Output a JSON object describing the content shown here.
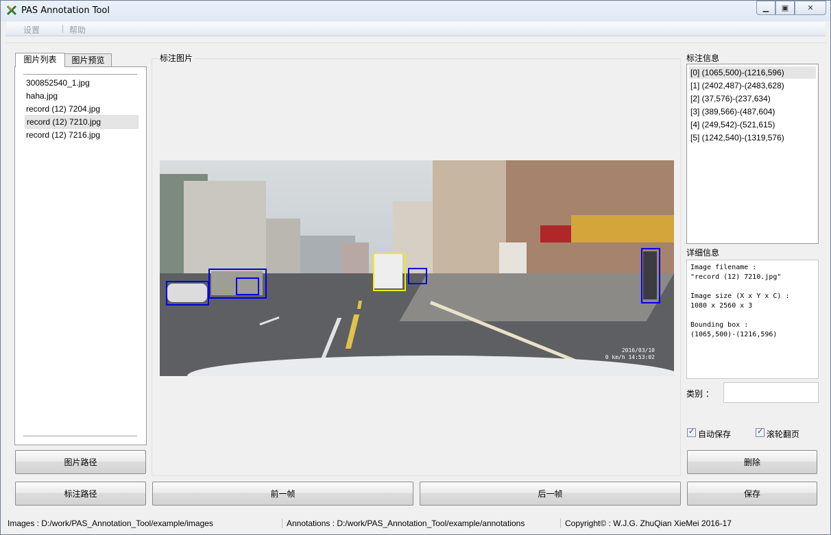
{
  "window": {
    "title": "PAS Annotation Tool"
  },
  "menu": {
    "settings": "设置",
    "help": "帮助"
  },
  "tabs": {
    "image_list": "图片列表",
    "image_preview": "图片预览"
  },
  "image_files": [
    "300852540_1.jpg",
    "haha.jpg",
    "record (12) 7204.jpg",
    "record (12) 7210.jpg",
    "record (12) 7216.jpg"
  ],
  "selected_file_index": 3,
  "center": {
    "label": "标注图片",
    "timestamp_line1": "2016/03/10",
    "timestamp_line2": "0 km/h 14:53:02"
  },
  "annotation": {
    "label": "标注信息",
    "items": [
      "[0] (1065,500)-(1216,596)",
      "[1] (2402,487)-(2483,628)",
      "[2] (37,576)-(237,634)",
      "[3] (389,566)-(487,604)",
      "[4] (249,542)-(521,615)",
      "[5] (1242,540)-(1319,576)"
    ]
  },
  "detail": {
    "label": "详细信息",
    "filename_title": "Image filename :",
    "filename_value": "\"record (12) 7210.jpg\"",
    "size_title": "Image size (X x Y x C) :",
    "size_value": "1080 x 2560 x 3",
    "bbox_title": "Bounding box :",
    "bbox_value": "(1065,500)-(1216,596)"
  },
  "category": {
    "label": "类别 ："
  },
  "options": {
    "auto_save": "自动保存",
    "auto_save_checked": true,
    "wheel_page": "滚轮翻页",
    "wheel_page_checked": true
  },
  "buttons": {
    "image_path": "图片路径",
    "delete": "删除",
    "annotation_path": "标注路径",
    "prev_frame": "前一帧",
    "next_frame": "后一帧",
    "save": "保存"
  },
  "status": {
    "images": "Images : D:/work/PAS_Annotation_Tool/example/images",
    "annotations": "Annotations : D:/work/PAS_Annotation_Tool/example/annotations",
    "copyright": "Copyright© : W.J.G. ZhuQian XieMei 2016-17"
  },
  "colors": {
    "bbox_normal": "#0000e8",
    "bbox_selected": "#f0ee00"
  },
  "icons": {
    "app": "pas-logo-icon",
    "minimize": "minimize-icon",
    "maximize": "maximize-icon",
    "close": "close-icon"
  }
}
